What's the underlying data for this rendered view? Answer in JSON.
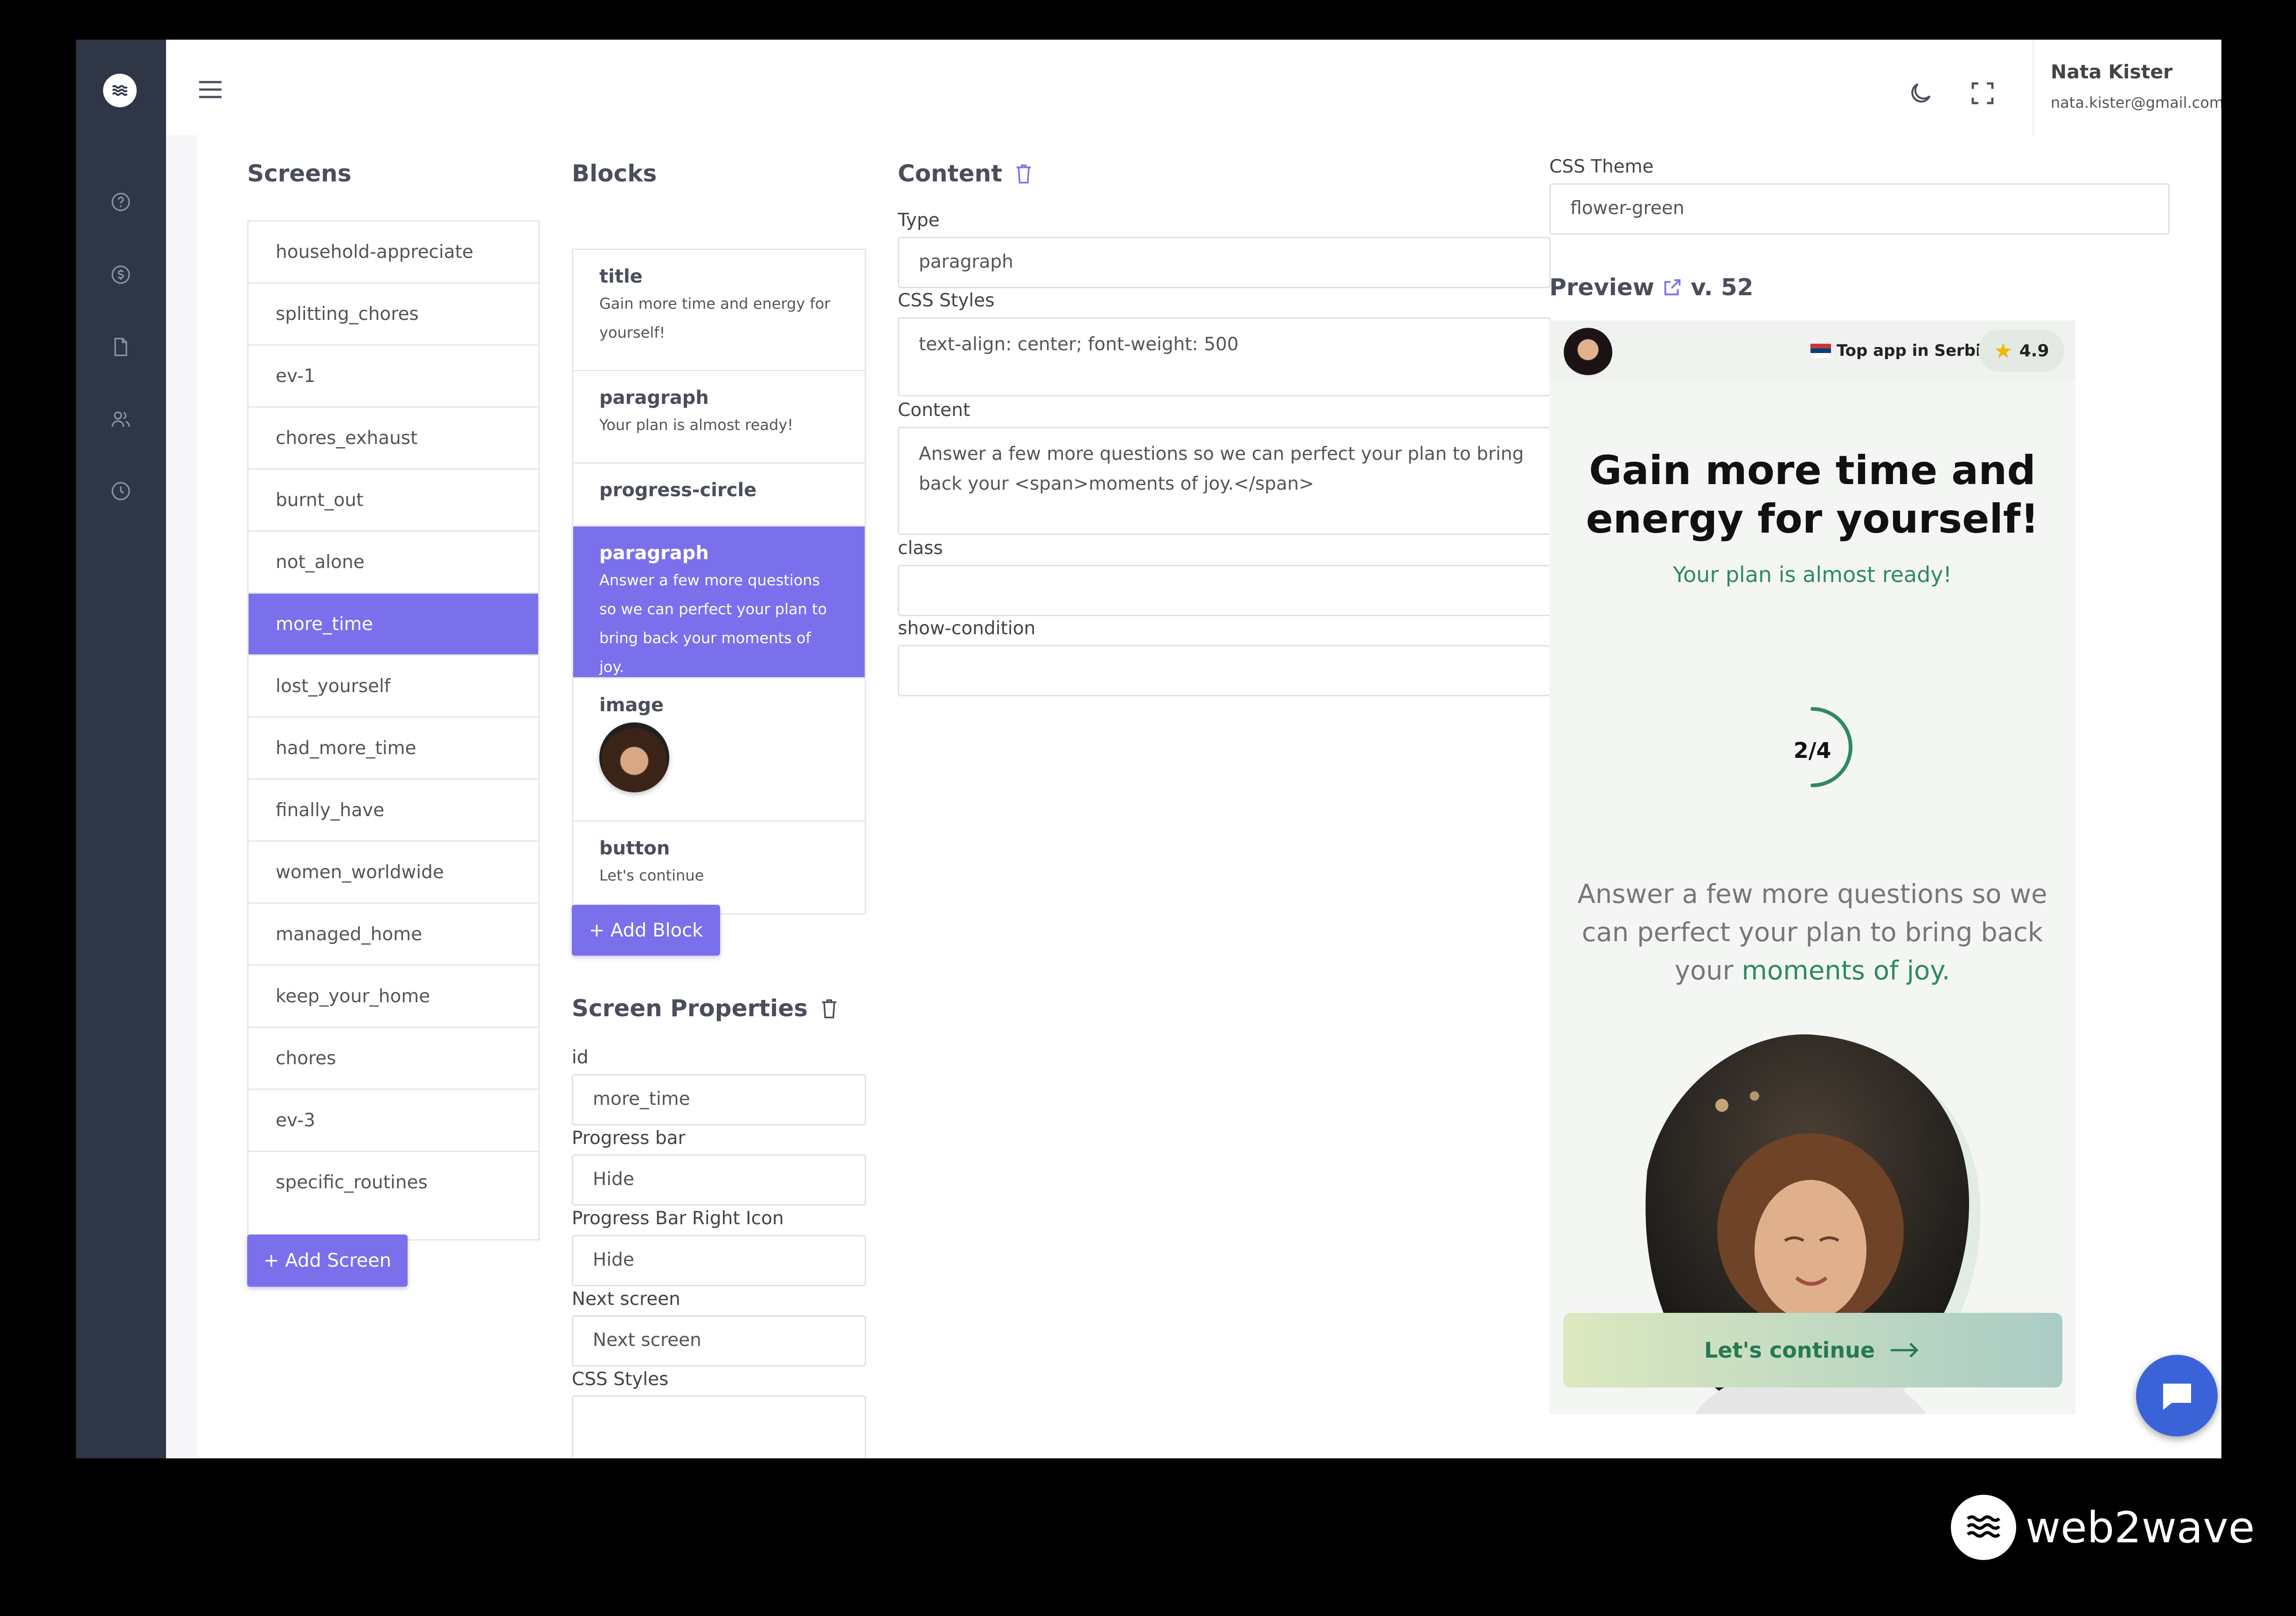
{
  "user": {
    "name": "Nata Kister",
    "email": "nata.kister@gmail.com"
  },
  "screens": {
    "title": "Screens",
    "items": [
      "household-appreciate",
      "splitting_chores",
      "ev-1",
      "chores_exhaust",
      "burnt_out",
      "not_alone",
      "more_time",
      "lost_yourself",
      "had_more_time",
      "finally_have",
      "women_worldwide",
      "managed_home",
      "keep_your_home",
      "chores",
      "ev-3",
      "specific_routines"
    ],
    "active": "more_time",
    "add_label": "+ Add Screen"
  },
  "blocks": {
    "title": "Blocks",
    "items": [
      {
        "type": "title",
        "text": "Gain more time and energy for yourself!"
      },
      {
        "type": "paragraph",
        "text": "Your plan is almost ready!"
      },
      {
        "type": "progress-circle",
        "text": ""
      },
      {
        "type": "paragraph",
        "text": "Answer a few more questions so we can perfect your plan to bring back your moments of joy.",
        "active": true
      },
      {
        "type": "image",
        "text": ""
      },
      {
        "type": "button",
        "text": "Let's continue"
      }
    ],
    "add_label": "+ Add Block"
  },
  "screen_properties": {
    "title": "Screen Properties",
    "id_label": "id",
    "id_value": "more_time",
    "progress_bar_label": "Progress bar",
    "progress_bar_value": "Hide",
    "progress_bar_right_icon_label": "Progress Bar Right Icon",
    "progress_bar_right_icon_value": "Hide",
    "next_screen_label": "Next screen",
    "next_screen_placeholder": "Next screen",
    "css_styles_label": "CSS Styles"
  },
  "content": {
    "title": "Content",
    "type_label": "Type",
    "type_value": "paragraph",
    "css_styles_label": "CSS Styles",
    "css_styles_value": "text-align: center; font-weight: 500",
    "content_label": "Content",
    "content_value": "Answer a few more questions so we can perfect your plan to bring back your <span>moments of joy.</span>",
    "class_label": "class",
    "class_value": "",
    "show_condition_label": "show-condition",
    "show_condition_value": ""
  },
  "css_theme": {
    "label": "CSS Theme",
    "value": "flower-green"
  },
  "preview": {
    "label": "Preview",
    "version": "v. 52",
    "badge_text": "Top app in Serbia",
    "rating": "4.9",
    "title": "Gain more time and energy for yourself!",
    "subtitle": "Your plan is almost ready!",
    "progress_label": "2/4",
    "progress_fraction": 0.5,
    "paragraph_main": "Answer a few more questions so we can perfect your plan to bring back your",
    "paragraph_accent": "moments of joy.",
    "button_label": "Let's continue"
  },
  "brand": {
    "name": "web2wave"
  },
  "colors": {
    "accent": "#7b70ec",
    "sidebar": "#2f3747",
    "preview_green": "#2e8a5f",
    "chat": "#3b63d8"
  },
  "icons": {
    "rail": [
      "help-circle-icon",
      "dollar-icon",
      "file-icon",
      "users-icon",
      "clock-icon"
    ],
    "topbar": [
      "hamburger-menu-icon",
      "moon-icon",
      "fullscreen-icon"
    ]
  }
}
